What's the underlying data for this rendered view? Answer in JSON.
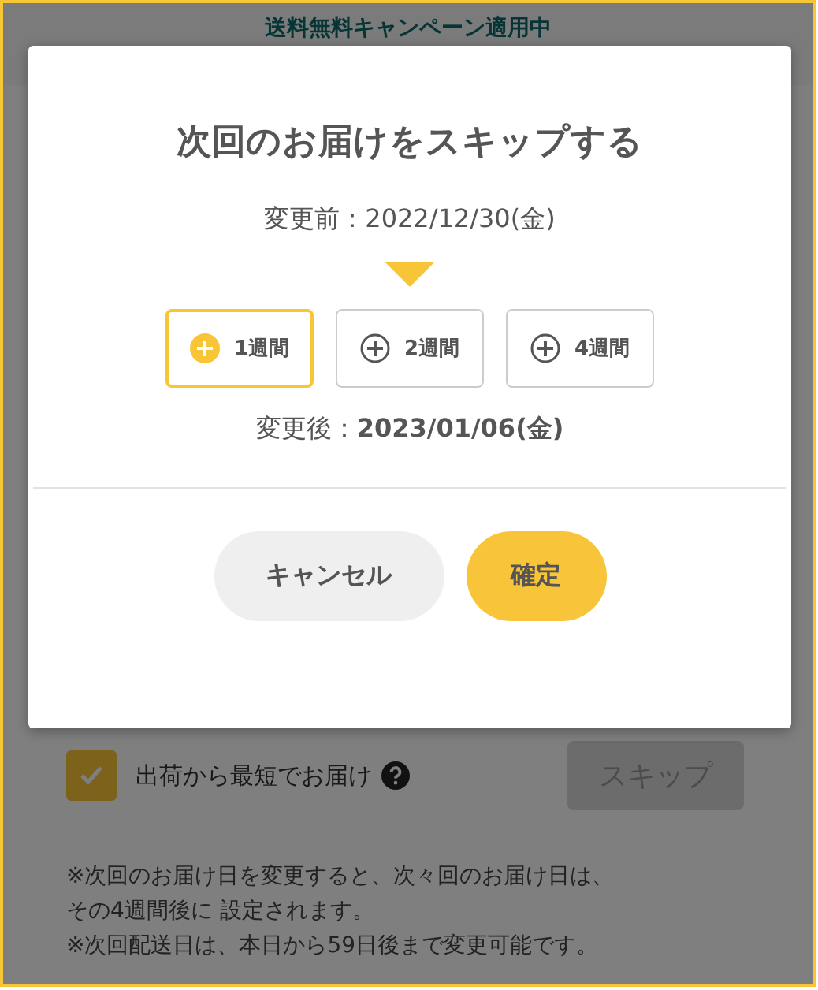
{
  "banner": "送料無料キャンペーン適用中",
  "dialog": {
    "title": "次回のお届けをスキップする",
    "before": {
      "label": "変更前：",
      "value": "2022/12/30(金)"
    },
    "options": [
      {
        "label": "1週間",
        "selected": true
      },
      {
        "label": "2週間",
        "selected": false
      },
      {
        "label": "4週間",
        "selected": false
      }
    ],
    "after": {
      "label": "変更後：",
      "value": "2023/01/06(金)"
    },
    "buttons": [
      {
        "kind": "cancel",
        "label": "キャンセル"
      },
      {
        "kind": "confirm",
        "label": "確定"
      }
    ]
  },
  "fastest": {
    "label": "出荷から最短でお届け",
    "checked": true
  },
  "skip_button": "スキップ",
  "notes": [
    {
      "lines": [
        "※次回のお届け日を変更すると、次々回のお届け日は、",
        "その4週間後に 設定されます。"
      ]
    },
    {
      "lines": [
        "※次回配送日は、本日から59日後まで変更可能です。"
      ]
    }
  ]
}
